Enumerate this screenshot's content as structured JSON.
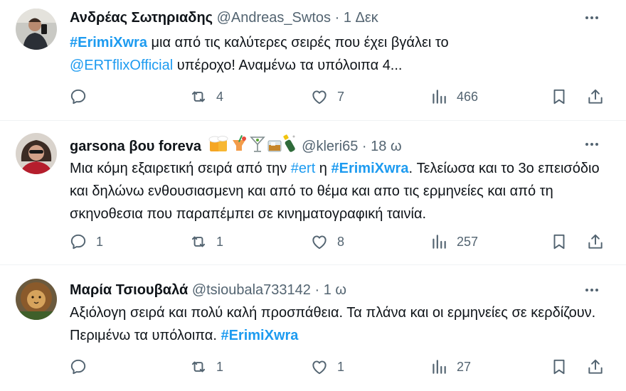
{
  "tweets": [
    {
      "name": "Ανδρέας Σωτηριαδης",
      "handle": "@Andreas_Swtos",
      "dot": "·",
      "time": "1 Δεκ",
      "text": {
        "tag1": "#ErimiXwra",
        "t1": " μια από τις καλύτερες σειρές που έχει βγάλει το",
        "mention": "@ERTflixOfficial",
        "t2": " υπέροχο! Αναμένω τα υπόλοιπα 4..."
      },
      "replies": "",
      "retweets": "4",
      "likes": "7",
      "views": "466"
    },
    {
      "name": "garsona βου foreva",
      "handle": "@kleri65",
      "dot": "·",
      "time": "18 ω",
      "text": {
        "t1": "Μια κόμη εξαιρετική σειρά από την ",
        "tag1": "#ert",
        "t2": " η ",
        "tag2": "#ErimiXwra",
        "t3": ". Τελείωσα και το 3ο επεισόδιο και δηλώνω ενθουσιασμενη και από το θέμα και απο τις ερμηνείες και από τη σκηνοθεσια που παραπέμπει σε κινηματογραφική ταινία."
      },
      "replies": "1",
      "retweets": "1",
      "likes": "8",
      "views": "257"
    },
    {
      "name": "Μαρία Τσιουβαλά",
      "handle": "@tsioubala733142",
      "dot": "·",
      "time": "1 ω",
      "text": {
        "t1": "Αξιόλογη σειρά και πολύ καλή προσπάθεια. Τα πλάνα και οι ερμηνείες σε κερδίζουν. Περιμένω τα υπόλοιπα. ",
        "tag1": "#ErimiXwra"
      },
      "replies": "",
      "retweets": "1",
      "likes": "1",
      "views": "27"
    }
  ],
  "colors": {
    "accent": "#1d9bf0",
    "muted": "#536471",
    "text": "#0f1419",
    "divider": "#eff3f4"
  },
  "icons": [
    "more-icon",
    "reply-icon",
    "retweet-icon",
    "like-icon",
    "views-icon",
    "bookmark-icon",
    "share-icon",
    "beer-emoji",
    "cocktail-emoji",
    "martini-emoji",
    "whiskey-emoji",
    "champagne-emoji"
  ]
}
